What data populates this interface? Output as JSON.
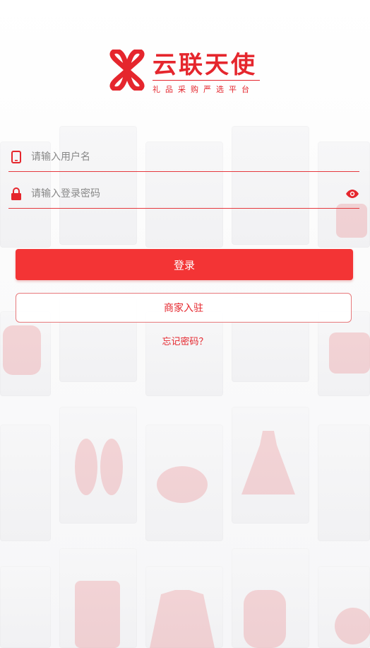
{
  "brand": {
    "title": "云联天使",
    "subtitle": "礼品采购严选平台"
  },
  "form": {
    "username_placeholder": "请输入用户名",
    "password_placeholder": "请输入登录密码",
    "login_label": "登录",
    "merchant_label": "商家入驻",
    "forgot_label": "忘记密码？"
  },
  "icons": {
    "username": "phone-icon",
    "password": "lock-icon",
    "toggle": "eye-icon"
  },
  "colors": {
    "accent": "#e5262d",
    "button": "#f33435"
  }
}
